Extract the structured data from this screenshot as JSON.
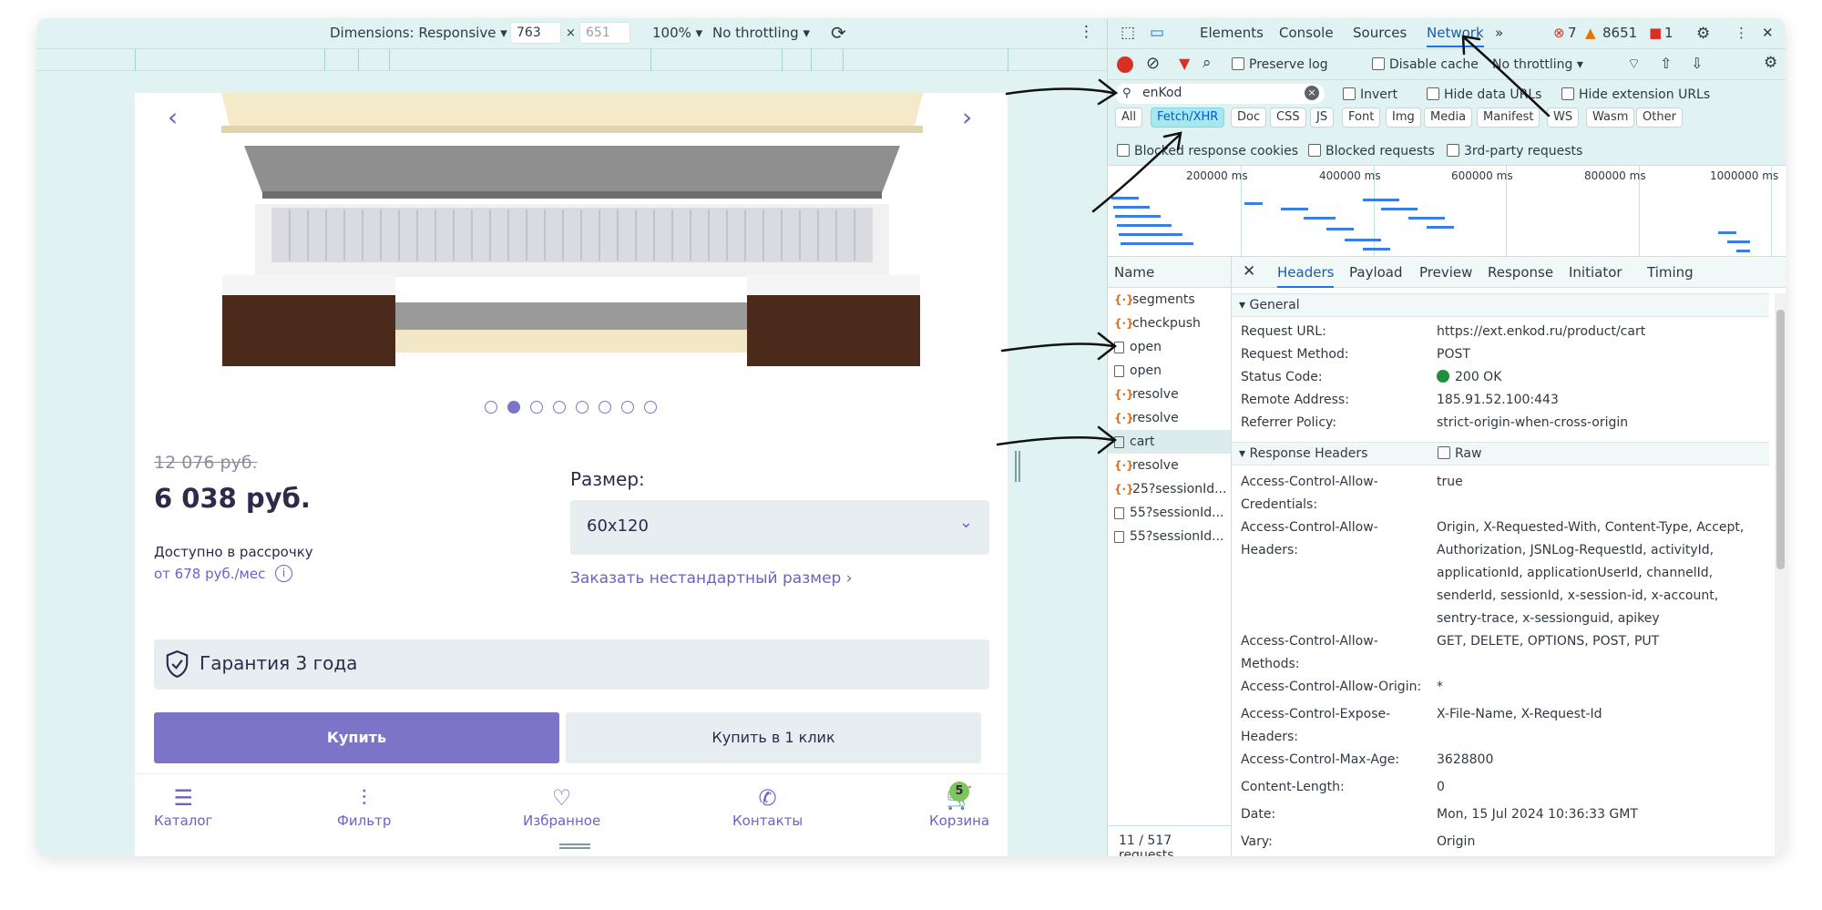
{
  "emulation_toolbar": {
    "dimensions_label": "Dimensions: Responsive ▾",
    "width": "763",
    "height": "651",
    "zoom": "100% ▾",
    "throttling": "No throttling ▾"
  },
  "product": {
    "old_price": "12 076 руб.",
    "price": "6 038 руб.",
    "installment_label": "Доступно в рассрочку",
    "monthly": "от 678 руб./мес",
    "size_label": "Размер:",
    "size_value": "60x120",
    "custom_size_link": "Заказать нестандартный размер ›",
    "warranty": "Гарантия 3 года",
    "buy_label": "Купить",
    "oneclick_label": "Купить в 1 клик",
    "carousel_total": 8,
    "carousel_active": 2
  },
  "bottom_nav": [
    {
      "label": "Каталог",
      "icon": "menu-icon"
    },
    {
      "label": "Фильтр",
      "icon": "filter-sliders-icon"
    },
    {
      "label": "Избранное",
      "icon": "heart-icon"
    },
    {
      "label": "Контакты",
      "icon": "phone-icon"
    },
    {
      "label": "Корзина",
      "icon": "cart-icon",
      "badge": "5"
    }
  ],
  "devtools": {
    "tabs": [
      "Elements",
      "Console",
      "Sources",
      "Network"
    ],
    "active_tab": "Network",
    "errors": "7",
    "warnings": "8651",
    "issues": "1",
    "preserve_log": "Preserve log",
    "disable_cache": "Disable cache",
    "throttling": "No throttling",
    "filter_value": "enKod",
    "invert": "Invert",
    "hide_data_urls": "Hide data URLs",
    "hide_extension_urls": "Hide extension URLs",
    "type_chips": [
      "All",
      "Fetch/XHR",
      "Doc",
      "CSS",
      "JS",
      "Font",
      "Img",
      "Media",
      "Manifest",
      "WS",
      "Wasm",
      "Other"
    ],
    "active_chip": "Fetch/XHR",
    "blocked_cookies": "Blocked response cookies",
    "blocked_requests": "Blocked requests",
    "third_party": "3rd-party requests",
    "timeline_labels": [
      "200000 ms",
      "400000 ms",
      "600000 ms",
      "800000 ms",
      "1000000 ms"
    ],
    "name_header": "Name",
    "requests": [
      {
        "name": "segments",
        "type": "xhr"
      },
      {
        "name": "checkpush",
        "type": "xhr"
      },
      {
        "name": "open",
        "type": "doc"
      },
      {
        "name": "open",
        "type": "doc"
      },
      {
        "name": "resolve",
        "type": "xhr"
      },
      {
        "name": "resolve",
        "type": "xhr"
      },
      {
        "name": "cart",
        "type": "doc",
        "selected": true
      },
      {
        "name": "resolve",
        "type": "xhr"
      },
      {
        "name": "25?sessionId...",
        "type": "xhr"
      },
      {
        "name": "55?sessionId...",
        "type": "doc"
      },
      {
        "name": "55?sessionId...",
        "type": "doc"
      }
    ],
    "request_count": "11 / 517 requests",
    "detail_tabs": [
      "Headers",
      "Payload",
      "Preview",
      "Response",
      "Initiator",
      "Timing"
    ],
    "active_detail_tab": "Headers",
    "general_title": "▾ General",
    "general": [
      {
        "k": "Request URL:",
        "v": "https://ext.enkod.ru/product/cart"
      },
      {
        "k": "Request Method:",
        "v": "POST"
      },
      {
        "k": "Status Code:",
        "v": "200 OK"
      },
      {
        "k": "Remote Address:",
        "v": "185.91.52.100:443"
      },
      {
        "k": "Referrer Policy:",
        "v": "strict-origin-when-cross-origin"
      }
    ],
    "response_title": "▾ Response Headers",
    "raw_label": "Raw",
    "response_headers": [
      {
        "k": "Access-Control-Allow-Credentials:",
        "v": "true"
      },
      {
        "k": "Access-Control-Allow-Headers:",
        "v": "Origin, X-Requested-With, Content-Type, Accept, Authorization, JSNLog-RequestId, activityId, applicationId, applicationUserId, channelId, senderId, sessionId, x-session-id, x-account, sentry-trace, x-sessionguid, apikey"
      },
      {
        "k": "Access-Control-Allow-Methods:",
        "v": "GET, DELETE, OPTIONS, POST, PUT"
      },
      {
        "k": "Access-Control-Allow-Origin:",
        "v": "*"
      },
      {
        "k": "Access-Control-Expose-Headers:",
        "v": "X-File-Name, X-Request-Id"
      },
      {
        "k": "Access-Control-Max-Age:",
        "v": "3628800"
      },
      {
        "k": "Content-Length:",
        "v": "0"
      },
      {
        "k": "Date:",
        "v": "Mon, 15 Jul 2024 10:36:33 GMT"
      },
      {
        "k": "Vary:",
        "v": "Origin"
      }
    ]
  },
  "colors": {
    "accent": "#7b74c9",
    "devtools_bg": "#e1f2f2",
    "active_chip": "#a5e9f0",
    "status_ok": "#1e8e3e"
  }
}
